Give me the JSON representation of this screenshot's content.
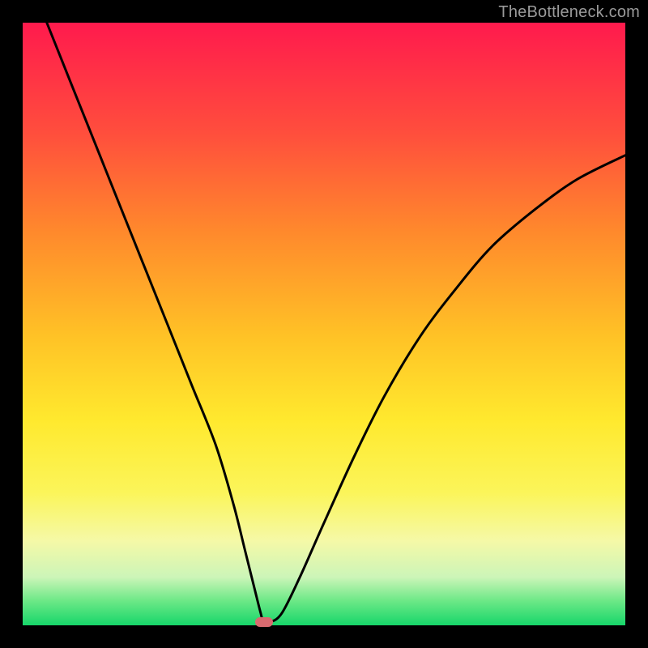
{
  "watermark": "TheBottleneck.com",
  "colors": {
    "frame": "#000000",
    "curve": "#000000",
    "marker": "#d86a6f",
    "gradient_stops": [
      "#ff1a4d",
      "#ff4d3d",
      "#ff8a2c",
      "#ffc226",
      "#ffe92e",
      "#fbf55a",
      "#f5f9a7",
      "#ccf5b8",
      "#6be886",
      "#17d66a"
    ]
  },
  "chart_data": {
    "type": "line",
    "title": "",
    "xlabel": "",
    "ylabel": "",
    "xlim": [
      0,
      100
    ],
    "ylim": [
      0,
      100
    ],
    "grid": false,
    "legend": false,
    "x": [
      4,
      8,
      12,
      16,
      20,
      24,
      28,
      32,
      35,
      37,
      38.5,
      39.5,
      40,
      41,
      43,
      46,
      50,
      55,
      60,
      66,
      72,
      78,
      85,
      92,
      100
    ],
    "y": [
      100,
      90,
      80,
      70,
      60,
      50,
      40,
      30,
      20,
      12,
      6,
      2,
      0.5,
      0.5,
      2,
      8,
      17,
      28,
      38,
      48,
      56,
      63,
      69,
      74,
      78
    ],
    "annotations": [
      {
        "type": "marker",
        "x": 40,
        "y": 0.5,
        "shape": "rounded_rect",
        "color": "#d86a6f"
      }
    ],
    "notes": "V-shaped bottleneck curve over a vertical red-to-green gradient background; axes are unlabeled; values are estimated from pixel positions on a 0–100 normalized scale for both axes."
  }
}
